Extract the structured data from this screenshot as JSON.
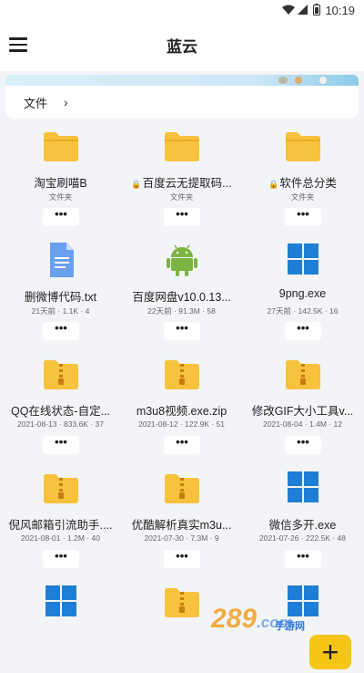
{
  "status": {
    "time": "10:19"
  },
  "header": {
    "title": "蓝云"
  },
  "breadcrumb": {
    "root": "文件",
    "chevron": "›"
  },
  "files": [
    {
      "name": "淘宝刷喵B",
      "meta": "文件夹",
      "type": "folder",
      "locked": false
    },
    {
      "name": "百度云无提取码...",
      "meta": "文件夹",
      "type": "folder",
      "locked": true
    },
    {
      "name": "软件总分类",
      "meta": "文件夹",
      "type": "folder",
      "locked": true
    },
    {
      "name": "删微博代码.txt",
      "meta": "21天前 · 1.1K · 4",
      "type": "txt",
      "locked": false
    },
    {
      "name": "百度网盘v10.0.13...",
      "meta": "22天前 · 91.3M · 58",
      "type": "apk",
      "locked": false
    },
    {
      "name": "9png.exe",
      "meta": "27天前 · 142.5K · 16",
      "type": "exe",
      "locked": false
    },
    {
      "name": "QQ在线状态-自定...",
      "meta": "2021-08-13 · 833.6K · 37",
      "type": "zip",
      "locked": false
    },
    {
      "name": "m3u8视频.exe.zip",
      "meta": "2021-08-12 · 122.9K · 51",
      "type": "zip",
      "locked": false
    },
    {
      "name": "修改GIF大小工具v...",
      "meta": "2021-08-04 · 1.4M · 12",
      "type": "zip",
      "locked": false
    },
    {
      "name": "倪风邮箱引流助手....",
      "meta": "2021-08-01 · 1.2M · 40",
      "type": "zip",
      "locked": false
    },
    {
      "name": "优酷解析真实m3u...",
      "meta": "2021-07-30 · 7.3M · 9",
      "type": "zip",
      "locked": false
    },
    {
      "name": "微信多开.exe",
      "meta": "2021-07-26 · 222.5K · 48",
      "type": "exe",
      "locked": false
    },
    {
      "name": "",
      "meta": "",
      "type": "exe",
      "locked": false
    },
    {
      "name": "",
      "meta": "",
      "type": "zip",
      "locked": false
    },
    {
      "name": "",
      "meta": "",
      "type": "exe",
      "locked": false
    }
  ],
  "more_label": "•••",
  "fab": {
    "label": "+"
  },
  "watermark": {
    "text": "289",
    "suffix": ".com",
    "tagline": "手游网"
  },
  "colors": {
    "folder": "#f7c23d",
    "exe": "#1f7fd6",
    "apk": "#7cb342",
    "txt": "#6aa0f0",
    "fab": "#f5c518"
  }
}
